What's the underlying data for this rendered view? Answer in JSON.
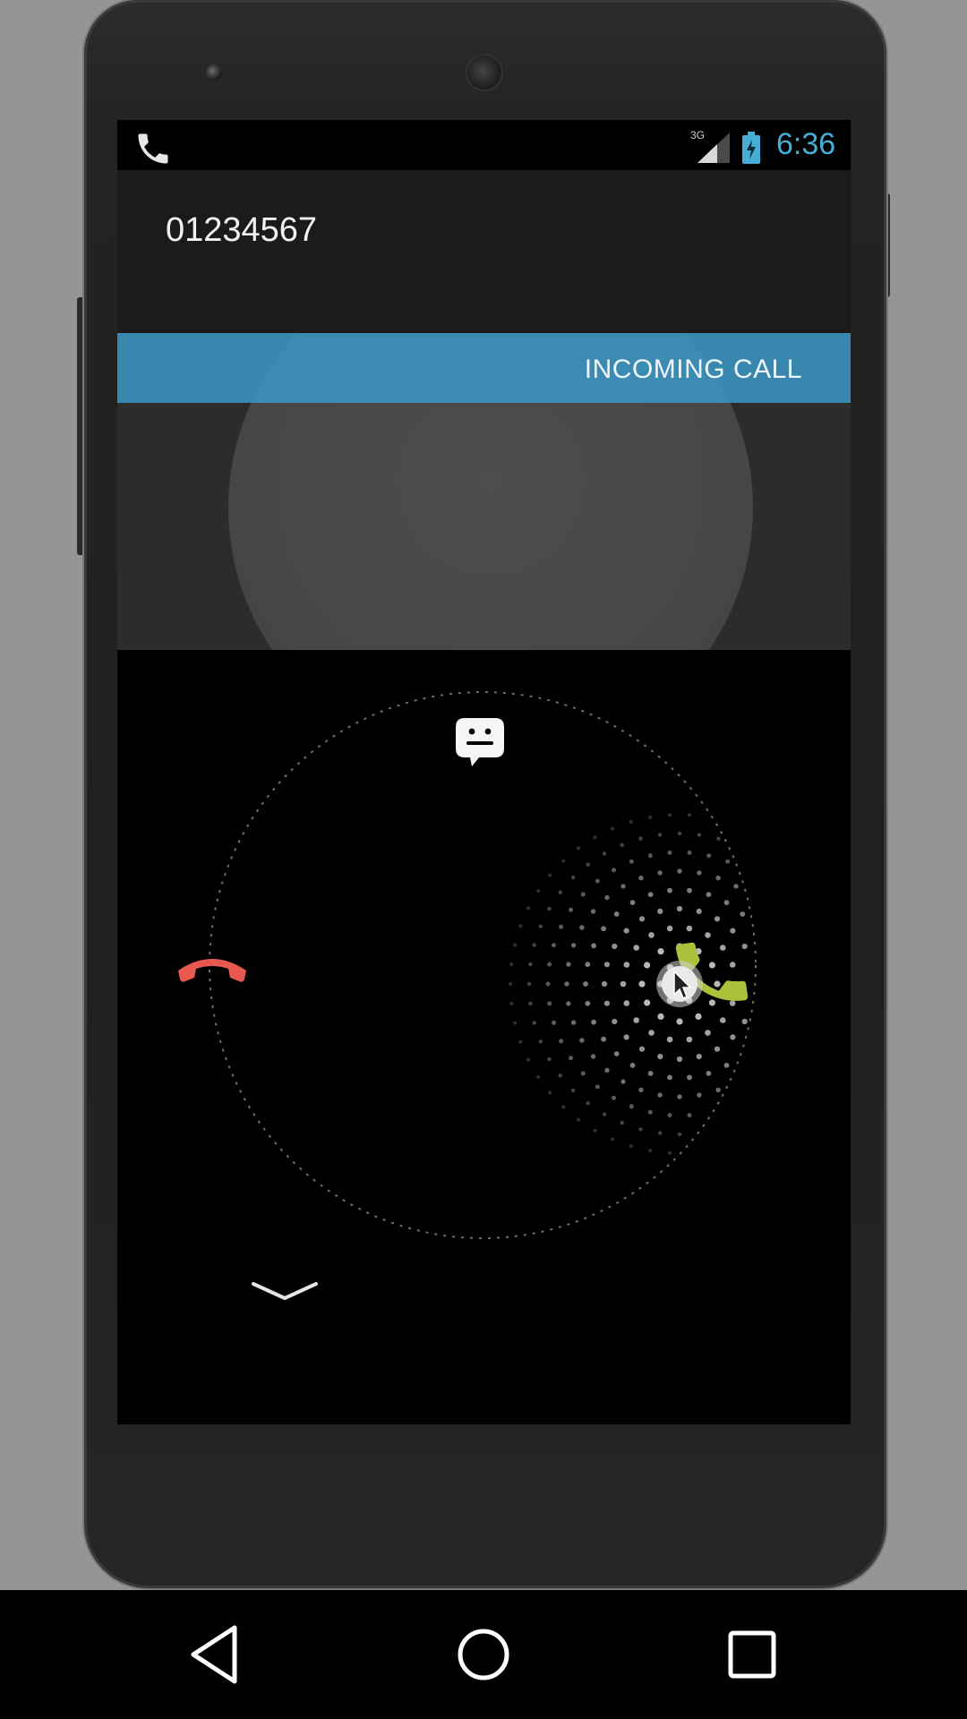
{
  "status_bar": {
    "time": "6:36",
    "network_type": "3G",
    "icons": [
      "phone-call-icon",
      "signal-3g-icon",
      "battery-charging-icon"
    ],
    "accent_color": "#44aed6"
  },
  "incoming_call": {
    "caller_number": "01234567",
    "banner_label": "INCOMING CALL",
    "banner_color": "#3a96c4"
  },
  "call_controls": {
    "decline_icon": "decline-call-icon",
    "message_icon": "message-reply-icon",
    "answer_icon": "answer-call-icon",
    "collapse_icon": "chevron-down-icon",
    "decline_color": "#e8584f",
    "answer_color": "#a9c23a"
  },
  "nav_bar": {
    "buttons": [
      "back-icon",
      "home-icon",
      "recents-icon"
    ]
  }
}
